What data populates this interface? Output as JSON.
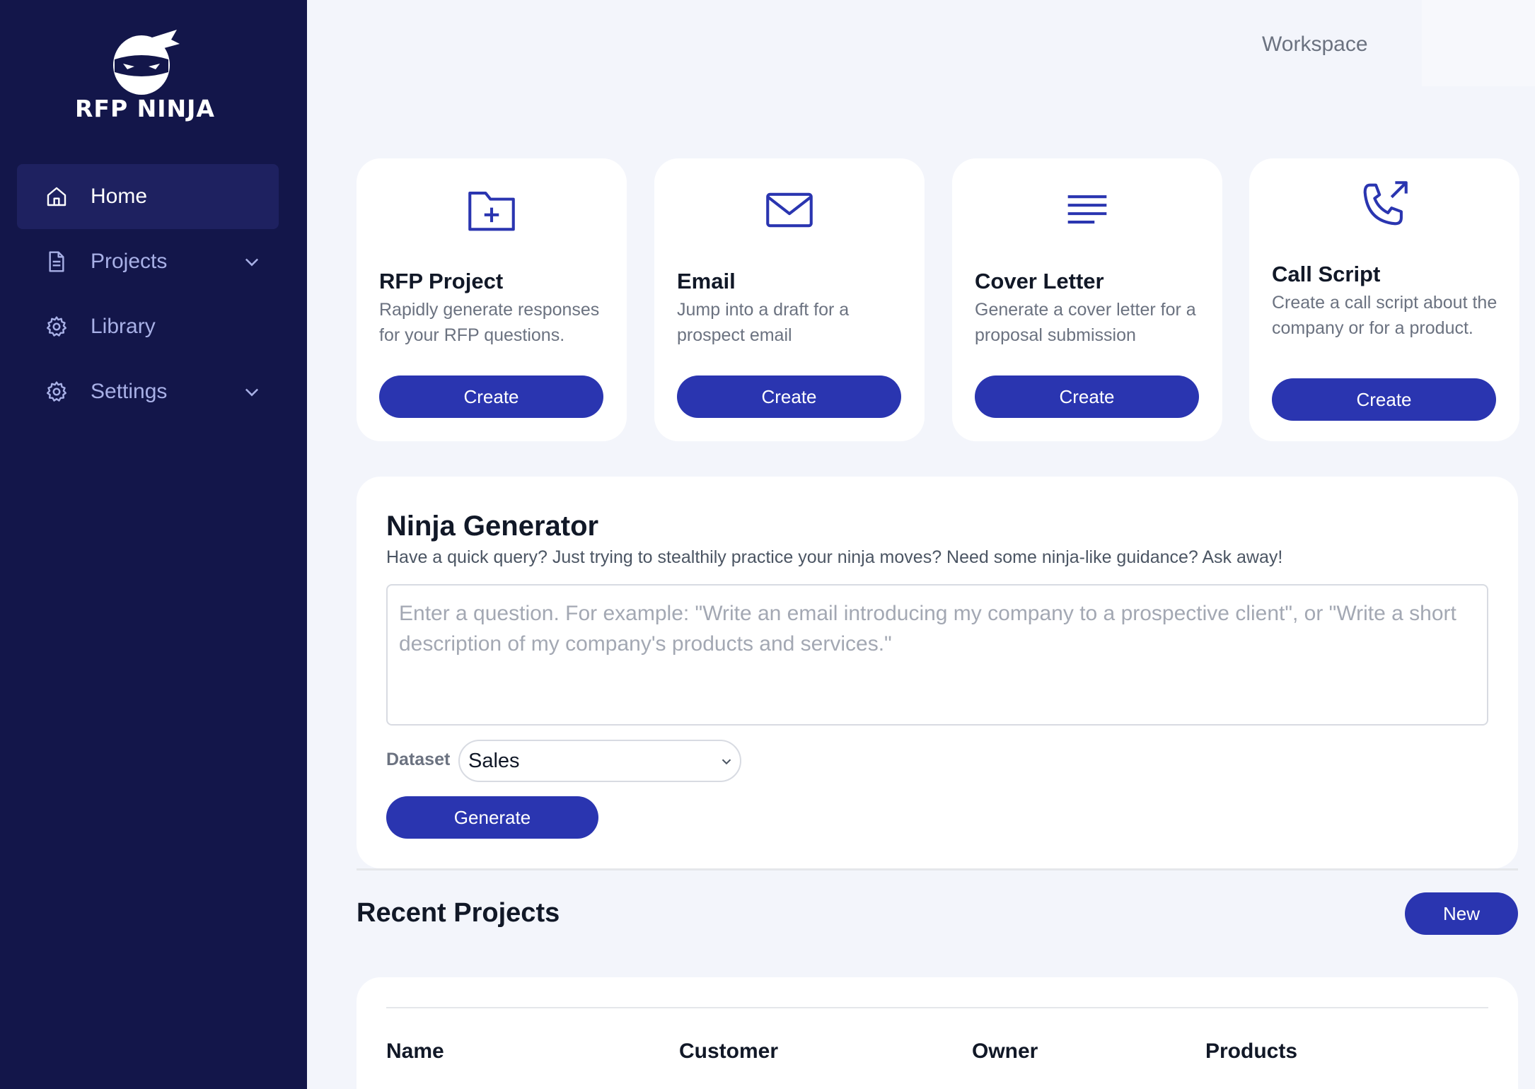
{
  "brand": {
    "name": "RFP NINJA"
  },
  "sidebar": {
    "items": [
      {
        "label": "Home",
        "icon": "home-icon",
        "active": true
      },
      {
        "label": "Projects",
        "icon": "document-icon",
        "expandable": true
      },
      {
        "label": "Library",
        "icon": "gear-icon"
      },
      {
        "label": "Settings",
        "icon": "gear-icon",
        "expandable": true
      }
    ]
  },
  "header": {
    "workspace_label": "Workspace"
  },
  "cards": [
    {
      "title": "RFP Project",
      "description": "Rapidly generate responses for your RFP questions.",
      "button": "Create",
      "icon": "folder-plus-icon"
    },
    {
      "title": "Email",
      "description": "Jump into a draft for a prospect email",
      "button": "Create",
      "icon": "mail-icon"
    },
    {
      "title": "Cover Letter",
      "description": "Generate a cover letter for a proposal submission",
      "button": "Create",
      "icon": "text-lines-icon"
    },
    {
      "title": "Call Script",
      "description": "Create a call script about the company or for a product.",
      "button": "Create",
      "icon": "phone-outgoing-icon"
    }
  ],
  "generator": {
    "title": "Ninja Generator",
    "subtitle": "Have a quick query? Just trying to stealthily practice your ninja moves? Need some ninja-like guidance?  Ask away!",
    "placeholder": "Enter a question. For example: \"Write an email introducing my company to a prospective client\", or \"Write a short description of my company's products and services.\"",
    "value": "",
    "dataset_label": "Dataset",
    "dataset_value": "Sales",
    "button": "Generate"
  },
  "recent": {
    "title": "Recent Projects",
    "new_button": "New",
    "columns": [
      "Name",
      "Customer",
      "Owner",
      "Products"
    ]
  },
  "colors": {
    "sidebar_bg": "#13164a",
    "accent": "#2a35b0",
    "page_bg": "#f3f5fb"
  }
}
